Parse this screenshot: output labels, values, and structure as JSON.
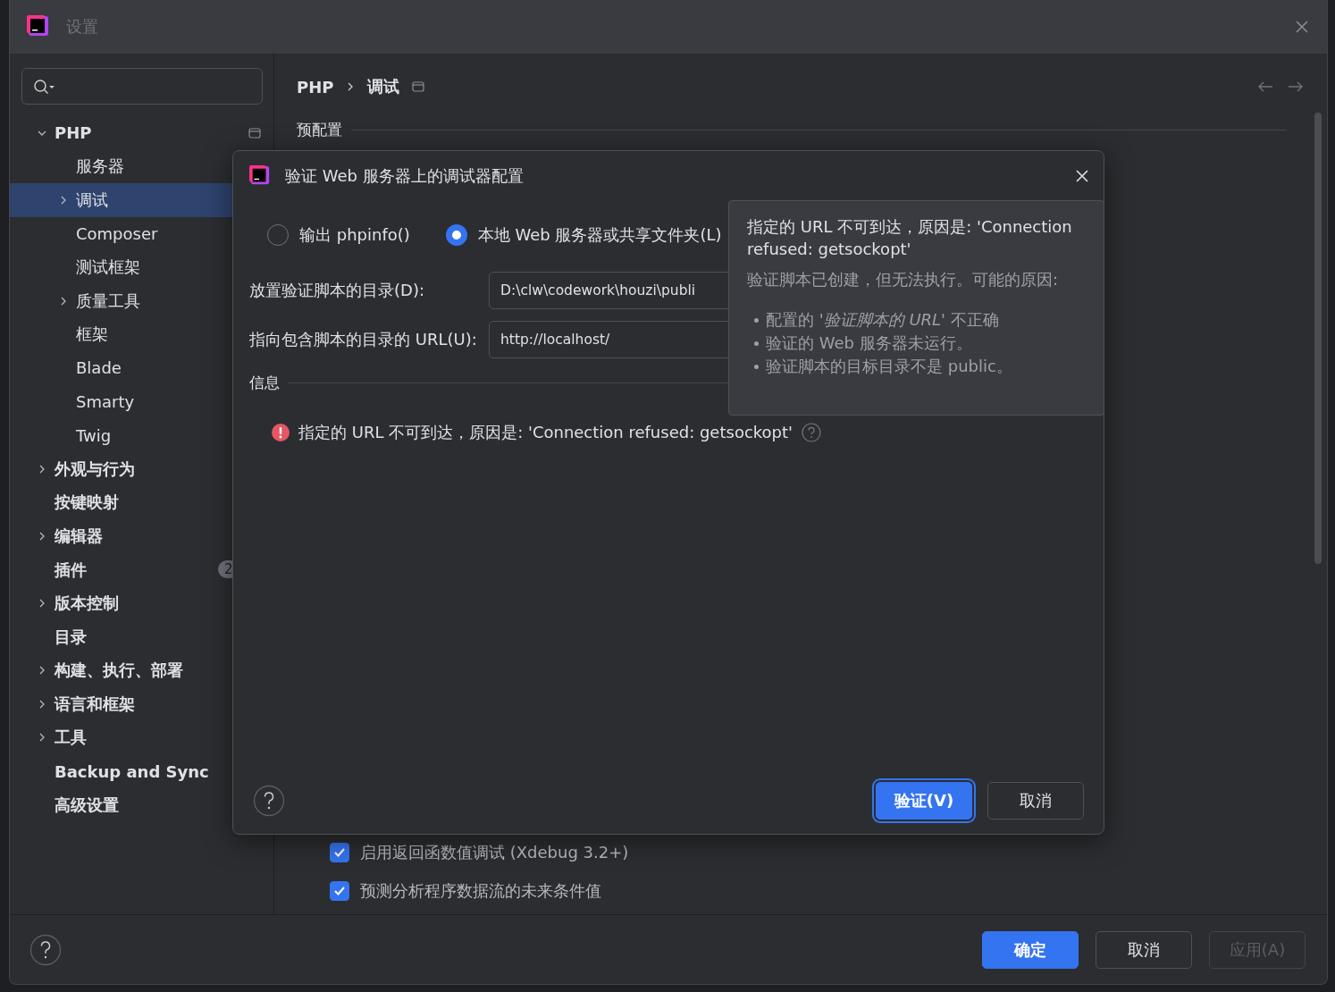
{
  "window": {
    "title": "设置"
  },
  "sidebar": {
    "items": [
      {
        "label": "PHP",
        "expanded": true,
        "selected": false,
        "children": [
          {
            "label": "服务器",
            "selected": false
          },
          {
            "label": "调试",
            "expanded": false,
            "selected": true
          },
          {
            "label": "Composer",
            "selected": false
          },
          {
            "label": "测试框架",
            "selected": false
          },
          {
            "label": "质量工具",
            "expanded": false,
            "selected": false
          },
          {
            "label": "框架",
            "selected": false
          },
          {
            "label": "Blade",
            "selected": false
          },
          {
            "label": "Smarty",
            "selected": false
          },
          {
            "label": "Twig",
            "selected": false
          }
        ]
      },
      {
        "label": "外观与行为",
        "expanded": false,
        "selected": false
      },
      {
        "label": "按键映射",
        "selected": false
      },
      {
        "label": "编辑器",
        "expanded": false,
        "selected": false
      },
      {
        "label": "插件",
        "selected": false,
        "badge": "2"
      },
      {
        "label": "版本控制",
        "expanded": false,
        "selected": false
      },
      {
        "label": "目录",
        "selected": false
      },
      {
        "label": "构建、执行、部署",
        "expanded": false,
        "selected": false
      },
      {
        "label": "语言和框架",
        "expanded": false,
        "selected": false
      },
      {
        "label": "工具",
        "expanded": false,
        "selected": false
      },
      {
        "label": "Backup and Sync",
        "selected": false
      },
      {
        "label": "高级设置",
        "selected": false
      }
    ]
  },
  "breadcrumb": [
    "PHP",
    "调试"
  ],
  "content": {
    "section_title": "预配置",
    "checkboxes": [
      {
        "label": "启用返回函数值调试 (Xdebug 3.2+)",
        "checked": true
      },
      {
        "label": "预测分析程序数据流的未来条件值",
        "checked": true
      }
    ]
  },
  "dialog": {
    "title": "验证 Web 服务器上的调试器配置",
    "radios": [
      {
        "label": "输出 phpinfo()",
        "selected": false
      },
      {
        "label": "本地 Web 服务器或共享文件夹(L)",
        "selected": true
      }
    ],
    "fields": [
      {
        "label": "放置验证脚本的目录(D):",
        "value": "D:\\clw\\codework\\houzi\\publi"
      },
      {
        "label": "指向包含脚本的目录的 URL(U):",
        "value": "http://localhost/"
      }
    ],
    "info_title": "信息",
    "message": "指定的 URL 不可到达，原因是: 'Connection refused: getsockopt'",
    "buttons": [
      {
        "label": "验证(V)",
        "kind": "primary"
      },
      {
        "label": "取消",
        "kind": "secondary"
      }
    ]
  },
  "tooltip": {
    "title": "指定的 URL 不可到达，原因是: 'Connection refused: getsockopt'",
    "subtitle": "验证脚本已创建，但无法执行。可能的原因:",
    "reasons": [
      "配置的 *'验证脚本的 URL'* 不正确",
      "验证的 Web 服务器未运行。",
      "验证脚本的目标目录不是 public。"
    ]
  },
  "footer": {
    "buttons": [
      {
        "label": "确定",
        "kind": "primary",
        "disabled": false
      },
      {
        "label": "取消",
        "kind": "secondary",
        "disabled": false
      },
      {
        "label": "应用(A)",
        "kind": "secondary",
        "disabled": true
      }
    ]
  }
}
